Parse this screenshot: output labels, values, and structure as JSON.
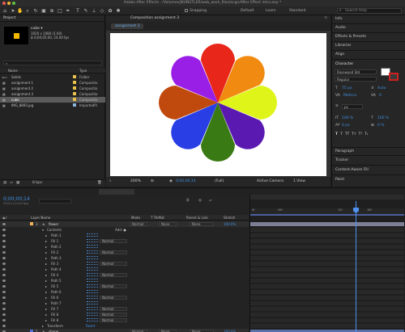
{
  "app": {
    "window_title": "Adobe After Effects - /Volumes/JKUNSTLER/web_work_files/ecgn/After Effect intro.aep *"
  },
  "toolbar": {
    "snapping": "Snapping",
    "workspaces": [
      "Default",
      "Learn",
      "Standard"
    ],
    "search_placeholder": "Search Help"
  },
  "project": {
    "panel_title": "Project",
    "selected_item": {
      "name": "cube ▾",
      "info1": "1920 x 1080 (1.00)",
      "info2": "Δ 0;00;05;00, 24.00 fps"
    },
    "columns": {
      "name": "Name",
      "type": "Type"
    },
    "items": [
      {
        "name": "Solids",
        "type": "Folder",
        "color": "#e8c14a"
      },
      {
        "name": "assignment 1",
        "type": "Compositio",
        "color": "#e8c14a"
      },
      {
        "name": "assignment 2",
        "type": "Compositio",
        "color": "#e8c14a"
      },
      {
        "name": "assignment 3",
        "type": "Compositio",
        "color": "#e8c14a"
      },
      {
        "name": "cube",
        "type": "Compositio",
        "color": "#e8c14a"
      },
      {
        "name": "IMG_8893.jpg",
        "type": "ImportedPl",
        "color": "#8ab4d8"
      }
    ],
    "footer_bpc": "8 bpc"
  },
  "composition": {
    "panel_title": "Composition assignment 3",
    "active_tab": "assignment 3",
    "zoom": "200%",
    "timecode": "0;00;00;14",
    "resolution": "(Full)",
    "camera": "Active Camera",
    "views": "1 View"
  },
  "flower": {
    "petals": [
      "#e8261a",
      "#f08a10",
      "#dff51a",
      "#5a1ab2",
      "#3a7a14",
      "#2a3ee6",
      "#c04a0e",
      "#9a1fe6"
    ]
  },
  "right_panels": {
    "sections_top": [
      "Info",
      "Audio",
      "Effects & Presets",
      "Libraries",
      "Align"
    ],
    "character": {
      "title": "Character",
      "font": "Rosewood Std",
      "style": "Regular",
      "size": "75 px",
      "leading": "Auto",
      "kerning": "Metrics",
      "tracking": "0",
      "stroke_unit": "px",
      "vscale": "100 %",
      "hscale": "100 %",
      "baseline": "0 px",
      "tsume": "0 %"
    },
    "sections_bottom": [
      "Paragraph",
      "Tracker",
      "Content-Aware Fill",
      "Paint"
    ]
  },
  "timeline": {
    "tabs": [
      {
        "label": "assignment 1",
        "active": false
      },
      {
        "label": "assignment 2",
        "active": false
      },
      {
        "label": "assignment 3",
        "active": true
      },
      {
        "label": "cube",
        "active": false
      }
    ],
    "timecode": "0;00;00;14",
    "frame_info": "00014 (24.00 fps)",
    "headers": {
      "layer_name": "Layer Name",
      "mode": "Mode",
      "trkmat": "T TrkMat",
      "parent": "Parent & Link",
      "stretch": "Stretch"
    },
    "ruler_marks": [
      "0f",
      "06f",
      "12f",
      "18f"
    ],
    "layer1": {
      "num": "3",
      "name": "flower",
      "mode": "Normal",
      "trkmat": "None",
      "parent": "None",
      "stretch": "100.0%"
    },
    "contents_label": "Contents",
    "add_label": "Add: ●",
    "rows": [
      {
        "name": "Path 1",
        "mode": ""
      },
      {
        "name": "Fill 1",
        "mode": "Normal"
      },
      {
        "name": "Path 2",
        "mode": ""
      },
      {
        "name": "Fill 2",
        "mode": "Normal"
      },
      {
        "name": "Path 3",
        "mode": ""
      },
      {
        "name": "Fill 3",
        "mode": "Normal"
      },
      {
        "name": "Path 4",
        "mode": ""
      },
      {
        "name": "Fill 4",
        "mode": "Normal"
      },
      {
        "name": "Path 5",
        "mode": ""
      },
      {
        "name": "Fill 5",
        "mode": "Normal"
      },
      {
        "name": "Path 6",
        "mode": ""
      },
      {
        "name": "Fill 6",
        "mode": "Normal"
      },
      {
        "name": "Path 7",
        "mode": ""
      },
      {
        "name": "Fill 7",
        "mode": "Normal"
      },
      {
        "name": "Fill 8",
        "mode": "Normal"
      },
      {
        "name": "Fill 8",
        "mode": "Normal"
      }
    ],
    "transform_label": "Transform",
    "reset_label": "Reset",
    "layer2": {
      "num": "5",
      "name": "shape",
      "mode": "Normal",
      "trkmat": "None",
      "parent": "None",
      "stretch": "100.0%"
    }
  }
}
